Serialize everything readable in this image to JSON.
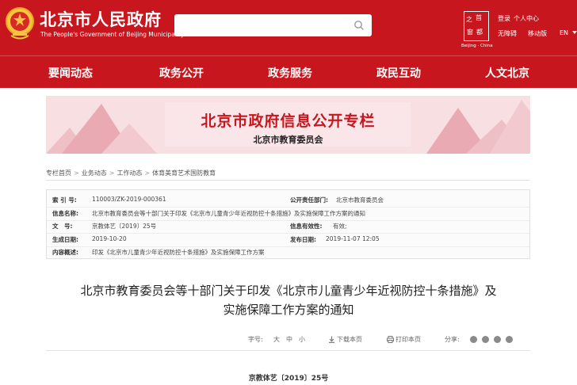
{
  "header": {
    "title_cn": "北京市人民政府",
    "title_en": "The People's Government of Beijing Municipality",
    "seal_chars": [
      "首",
      "都",
      "之",
      "窗"
    ],
    "seal_sub": "Beijing · China",
    "links": {
      "login": "登录",
      "personal": "个人中心",
      "accessible": "无障碍",
      "mobile": "移动版",
      "lang": "EN"
    }
  },
  "nav": {
    "items": [
      "要闻动态",
      "政务公开",
      "政务服务",
      "政民互动",
      "人文北京"
    ]
  },
  "banner": {
    "title": "北京市政府信息公开专栏",
    "subtitle": "北京市教育委员会"
  },
  "breadcrumb": [
    "专栏首页",
    "业务动态",
    "工作动态",
    "体育美育艺术国防教育"
  ],
  "info": {
    "index_label": "索 引 号:",
    "index_value": "110003/ZK-2019-000361",
    "dept_label": "公开责任部门:",
    "dept_value": "北京市教育委员会",
    "name_label": "信息名称:",
    "name_value": "北京市教育委员会等十部门关于印发《北京市儿童青少年近视防控十条措施》及实施保障工作方案的通知",
    "doc_label": "文　号:",
    "doc_value": "京教体艺〔2019〕25号",
    "validity_label": "信息有效性:",
    "validity_value": "有效;",
    "created_label": "生成日期:",
    "created_value": "2019-10-20",
    "published_label": "发布日期:",
    "published_value": "2019-11-07 12:05",
    "summary_label": "内容概述:",
    "summary_value": "印发《北京市儿童青少年近视防控十条措施》及实施保障工作方案"
  },
  "article": {
    "title_line1": "北京市教育委员会等十部门关于印发《北京市儿童青少年近视防控十条措施》及",
    "title_line2": "实施保障工作方案的通知",
    "font_label": "字号:",
    "font_large": "大",
    "font_medium": "中",
    "font_small": "小",
    "download": "下载本页",
    "print": "打印本页",
    "share_label": "分享:",
    "doc_no": "京教体艺〔2019〕25号"
  },
  "colors": {
    "brand_red": "#c8161e",
    "banner_bg": "#f7dfe2"
  }
}
